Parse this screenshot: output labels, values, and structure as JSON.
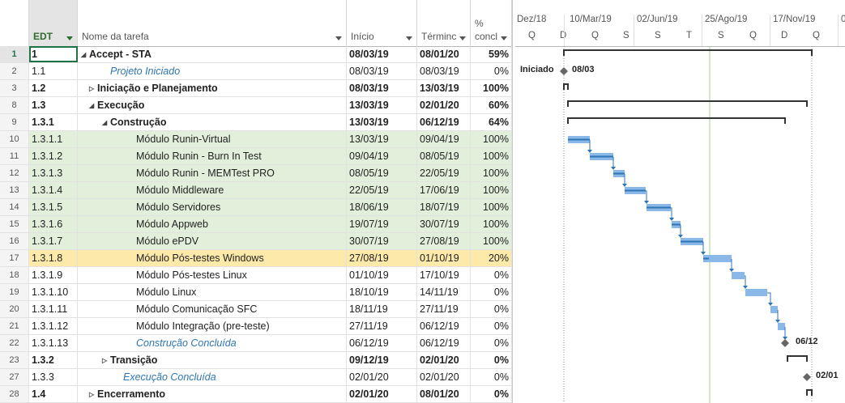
{
  "columns": {
    "edt": "EDT",
    "name": "Nome da tarefa",
    "start": "Início",
    "end": "Términc",
    "pct_top": "%",
    "pct": "concl"
  },
  "timescale": {
    "top": [
      "Dez/18",
      "10/Mar/19",
      "02/Jun/19",
      "25/Ago/19",
      "17/Nov/19",
      "0"
    ],
    "bottom": [
      "Q",
      "D",
      "Q",
      "S",
      "S",
      "T",
      "S",
      "Q",
      "D",
      "Q"
    ]
  },
  "rows": [
    {
      "num": "1",
      "edt": "1",
      "name": "Accept - STA",
      "start": "08/03/19",
      "end": "08/01/20",
      "pct": "59%",
      "level": 0,
      "bold": true,
      "collapse": "down",
      "bg": "none",
      "milestone": false
    },
    {
      "num": "2",
      "edt": "1.1",
      "name": "Projeto Iniciado",
      "start": "08/03/19",
      "end": "08/03/19",
      "pct": "0%",
      "level": 2,
      "bold": false,
      "collapse": "",
      "bg": "none",
      "milestone": true
    },
    {
      "num": "3",
      "edt": "1.2",
      "name": "Iniciação e Planejamento",
      "start": "08/03/19",
      "end": "13/03/19",
      "pct": "100%",
      "level": 1,
      "bold": true,
      "collapse": "right",
      "bg": "none",
      "milestone": false
    },
    {
      "num": "8",
      "edt": "1.3",
      "name": "Execução",
      "start": "13/03/19",
      "end": "02/01/20",
      "pct": "60%",
      "level": 1,
      "bold": true,
      "collapse": "down",
      "bg": "none",
      "milestone": false
    },
    {
      "num": "9",
      "edt": "1.3.1",
      "name": "Construção",
      "start": "13/03/19",
      "end": "06/12/19",
      "pct": "64%",
      "level": 2,
      "bold": true,
      "collapse": "down",
      "bg": "none",
      "milestone": false
    },
    {
      "num": "10",
      "edt": "1.3.1.1",
      "name": "Módulo Runin-Virtual",
      "start": "13/03/19",
      "end": "09/04/19",
      "pct": "100%",
      "level": 4,
      "bold": false,
      "collapse": "",
      "bg": "green",
      "milestone": false
    },
    {
      "num": "11",
      "edt": "1.3.1.2",
      "name": "Módulo Runin - Burn In Test",
      "start": "09/04/19",
      "end": "08/05/19",
      "pct": "100%",
      "level": 4,
      "bold": false,
      "collapse": "",
      "bg": "green",
      "milestone": false
    },
    {
      "num": "12",
      "edt": "1.3.1.3",
      "name": "Módulo Runin - MEMTest PRO",
      "start": "08/05/19",
      "end": "22/05/19",
      "pct": "100%",
      "level": 4,
      "bold": false,
      "collapse": "",
      "bg": "green",
      "milestone": false
    },
    {
      "num": "13",
      "edt": "1.3.1.4",
      "name": "Módulo Middleware",
      "start": "22/05/19",
      "end": "17/06/19",
      "pct": "100%",
      "level": 4,
      "bold": false,
      "collapse": "",
      "bg": "green",
      "milestone": false
    },
    {
      "num": "14",
      "edt": "1.3.1.5",
      "name": "Módulo Servidores",
      "start": "18/06/19",
      "end": "18/07/19",
      "pct": "100%",
      "level": 4,
      "bold": false,
      "collapse": "",
      "bg": "green",
      "milestone": false
    },
    {
      "num": "15",
      "edt": "1.3.1.6",
      "name": "Módulo Appweb",
      "start": "19/07/19",
      "end": "30/07/19",
      "pct": "100%",
      "level": 4,
      "bold": false,
      "collapse": "",
      "bg": "green",
      "milestone": false
    },
    {
      "num": "16",
      "edt": "1.3.1.7",
      "name": "Módulo ePDV",
      "start": "30/07/19",
      "end": "27/08/19",
      "pct": "100%",
      "level": 4,
      "bold": false,
      "collapse": "",
      "bg": "green",
      "milestone": false
    },
    {
      "num": "17",
      "edt": "1.3.1.8",
      "name": "Módulo Pós-testes Windows",
      "start": "27/08/19",
      "end": "01/10/19",
      "pct": "20%",
      "level": 4,
      "bold": false,
      "collapse": "",
      "bg": "yellow",
      "milestone": false
    },
    {
      "num": "18",
      "edt": "1.3.1.9",
      "name": "Módulo Pós-testes Linux",
      "start": "01/10/19",
      "end": "17/10/19",
      "pct": "0%",
      "level": 4,
      "bold": false,
      "collapse": "",
      "bg": "none",
      "milestone": false
    },
    {
      "num": "19",
      "edt": "1.3.1.10",
      "name": "Módulo Linux",
      "start": "18/10/19",
      "end": "14/11/19",
      "pct": "0%",
      "level": 4,
      "bold": false,
      "collapse": "",
      "bg": "none",
      "milestone": false
    },
    {
      "num": "20",
      "edt": "1.3.1.11",
      "name": "Módulo Comunicação SFC",
      "start": "18/11/19",
      "end": "27/11/19",
      "pct": "0%",
      "level": 4,
      "bold": false,
      "collapse": "",
      "bg": "none",
      "milestone": false
    },
    {
      "num": "21",
      "edt": "1.3.1.12",
      "name": "Módulo Integração (pre-teste)",
      "start": "27/11/19",
      "end": "06/12/19",
      "pct": "0%",
      "level": 4,
      "bold": false,
      "collapse": "",
      "bg": "none",
      "milestone": false
    },
    {
      "num": "22",
      "edt": "1.3.1.13",
      "name": "Construção Concluída",
      "start": "06/12/19",
      "end": "06/12/19",
      "pct": "0%",
      "level": 4,
      "bold": false,
      "collapse": "",
      "bg": "none",
      "milestone": true
    },
    {
      "num": "23",
      "edt": "1.3.2",
      "name": "Transição",
      "start": "09/12/19",
      "end": "02/01/20",
      "pct": "0%",
      "level": 2,
      "bold": true,
      "collapse": "right",
      "bg": "none",
      "milestone": false
    },
    {
      "num": "27",
      "edt": "1.3.3",
      "name": "Execução Concluída",
      "start": "02/01/20",
      "end": "02/01/20",
      "pct": "0%",
      "level": 3,
      "bold": false,
      "collapse": "",
      "bg": "none",
      "milestone": true
    },
    {
      "num": "28",
      "edt": "1.4",
      "name": "Encerramento",
      "start": "02/01/20",
      "end": "08/01/20",
      "pct": "0%",
      "level": 1,
      "bold": true,
      "collapse": "right",
      "bg": "none",
      "milestone": false
    }
  ],
  "gantt_labels": {
    "projeto_iniciado": "Iniciado",
    "projeto_iniciado_date": "08/03",
    "construcao_concluida_date": "06/12",
    "execucao_concluida_date": "02/01"
  },
  "colors": {
    "task_bar": "#8ab8e8",
    "task_progress": "#2e75b6",
    "summary": "#333333",
    "milestone": "#666666",
    "today_line": "#a9d18e",
    "green_row": "#e2efda",
    "selected_row": "#fde9a9"
  }
}
